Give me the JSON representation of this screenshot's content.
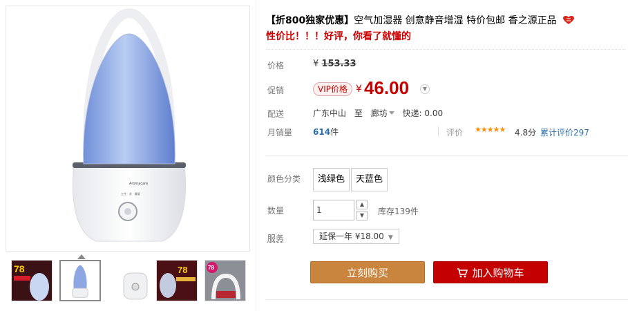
{
  "product": {
    "title_bold": "【折800独家优惠】",
    "title_rest": "空气加湿器 创意静音增湿 特价包邮 香之源正品",
    "subtitle": "性价比！！！好评，你看了就懂的",
    "brand_on_image": "Aromacare"
  },
  "price": {
    "label": "价格",
    "currency": "¥",
    "original": "153.33"
  },
  "promo": {
    "label": "促销",
    "badge": "VIP价格",
    "currency": "¥",
    "price": "46.00"
  },
  "shipping": {
    "label": "配送",
    "from": "广东中山",
    "to_word": "至",
    "to": "廊坊",
    "courier": "快递: 0.00"
  },
  "sales": {
    "label": "月销量",
    "count": "614",
    "unit": "件",
    "rating_label": "评价",
    "stars": "★★★★★",
    "score": "4.8分",
    "reviews": "累计评价297"
  },
  "options": {
    "color_label": "颜色分类",
    "colors": [
      "浅绿色",
      "天蓝色"
    ],
    "qty_label": "数量",
    "qty_value": "1",
    "stock": "库存139件",
    "service_label": "服务",
    "service_value": "延保一年  ¥18.00"
  },
  "actions": {
    "buy": "立刻购买",
    "cart": "加入购物车"
  },
  "thumbnails": [
    "78",
    "",
    "",
    "78",
    "78"
  ],
  "colors": {
    "price_red": "#c40000",
    "buy_button": "#c9853e",
    "cart_button": "#c40000",
    "link_blue": "#2b6ea8"
  }
}
